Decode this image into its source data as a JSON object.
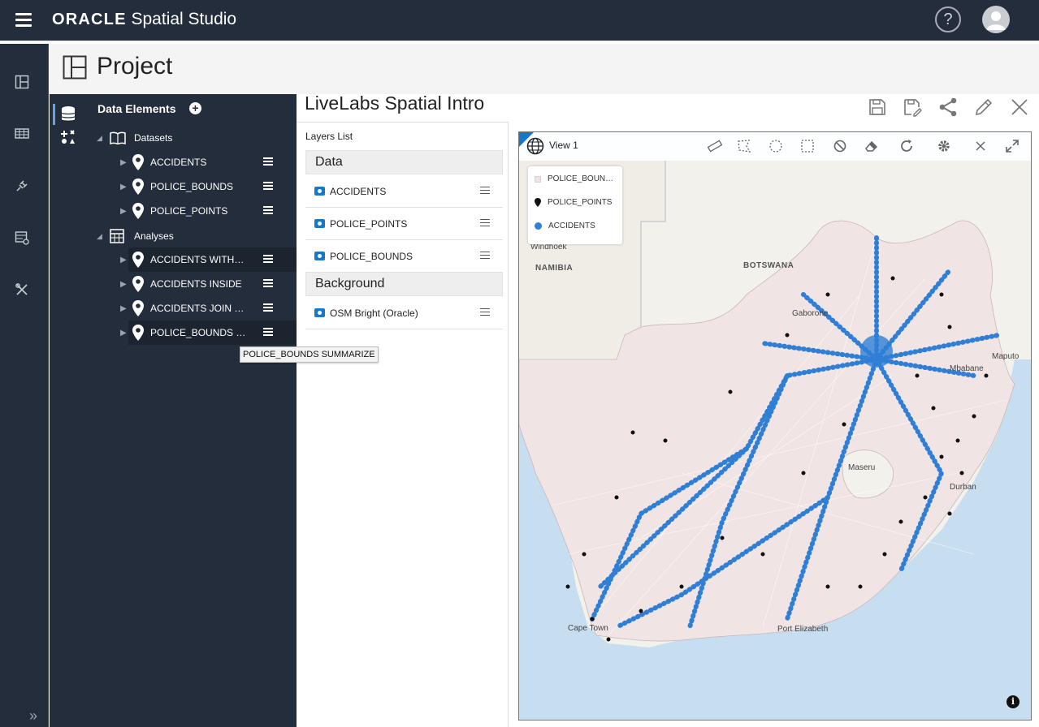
{
  "app": {
    "brand_oracle": "ORACLE",
    "brand_product": "Spatial Studio",
    "help": "?"
  },
  "project": {
    "title": "Project"
  },
  "data_panel": {
    "title": "Data Elements",
    "datasets_label": "Datasets",
    "analyses_label": "Analyses",
    "datasets": [
      "ACCIDENTS",
      "POLICE_BOUNDS",
      "POLICE_POINTS"
    ],
    "analyses": [
      "ACCIDENTS WITHIN DISTANCE",
      "ACCIDENTS INSIDE",
      "ACCIDENTS JOIN POLICE",
      "POLICE_BOUNDS SUMMARIZE"
    ]
  },
  "tooltip": "POLICE_BOUNDS SUMMARIZE",
  "content": {
    "title": "LiveLabs Spatial Intro"
  },
  "layers": {
    "title": "Layers List",
    "data_section": "Data",
    "background_section": "Background",
    "data_layers": [
      "ACCIDENTS",
      "POLICE_POINTS",
      "POLICE_BOUNDS"
    ],
    "background_layers": [
      "OSM Bright (Oracle)"
    ]
  },
  "map": {
    "view_label": "View 1",
    "legend": [
      "POLICE_BOUNDS",
      "POLICE_POINTS",
      "ACCIDENTS"
    ],
    "labels": {
      "windhoek": "Windhoek",
      "namibia": "NAMIBIA",
      "botswana": "BOTSWANA",
      "gaborone": "Gaborone",
      "maputo": "Maputo",
      "mbabane": "Mbabane",
      "maseru": "Maseru",
      "durban": "Durban",
      "cape_town": "Cape Town",
      "port_elizabeth": "Port Elizabeth"
    },
    "colors": {
      "accidents": "#2f7fd6",
      "police_points": "#111111",
      "police_bounds": "#f1e4e4",
      "water": "#c7ddf0",
      "land": "#f3f1ec"
    }
  },
  "icons": {
    "menu": "hamburger-icon",
    "help": "help-icon",
    "user": "user-avatar-icon",
    "save": "save-icon",
    "save_as": "save-as-icon",
    "share": "share-icon",
    "edit": "edit-icon",
    "close": "close-icon"
  }
}
